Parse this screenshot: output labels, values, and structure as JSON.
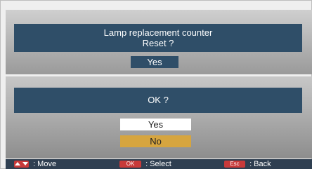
{
  "dialog_upper": {
    "line1": "Lamp replacement counter",
    "line2": "Reset ?",
    "selected_value": "Yes"
  },
  "dialog_lower": {
    "question": "OK ?",
    "options": [
      "Yes",
      "No"
    ],
    "highlighted_option": "No"
  },
  "footer": {
    "move_label": ": Move",
    "ok_key": "OK",
    "select_label": ": Select",
    "esc_key": "Esc",
    "back_label": ": Back"
  },
  "colors": {
    "panel_blue": "#2f4e68",
    "highlight": "#d6a53f",
    "key_red": "#c83a3a",
    "footer_bar": "#2f3f51"
  },
  "icons": [
    "up-arrow-icon",
    "down-arrow-icon"
  ]
}
